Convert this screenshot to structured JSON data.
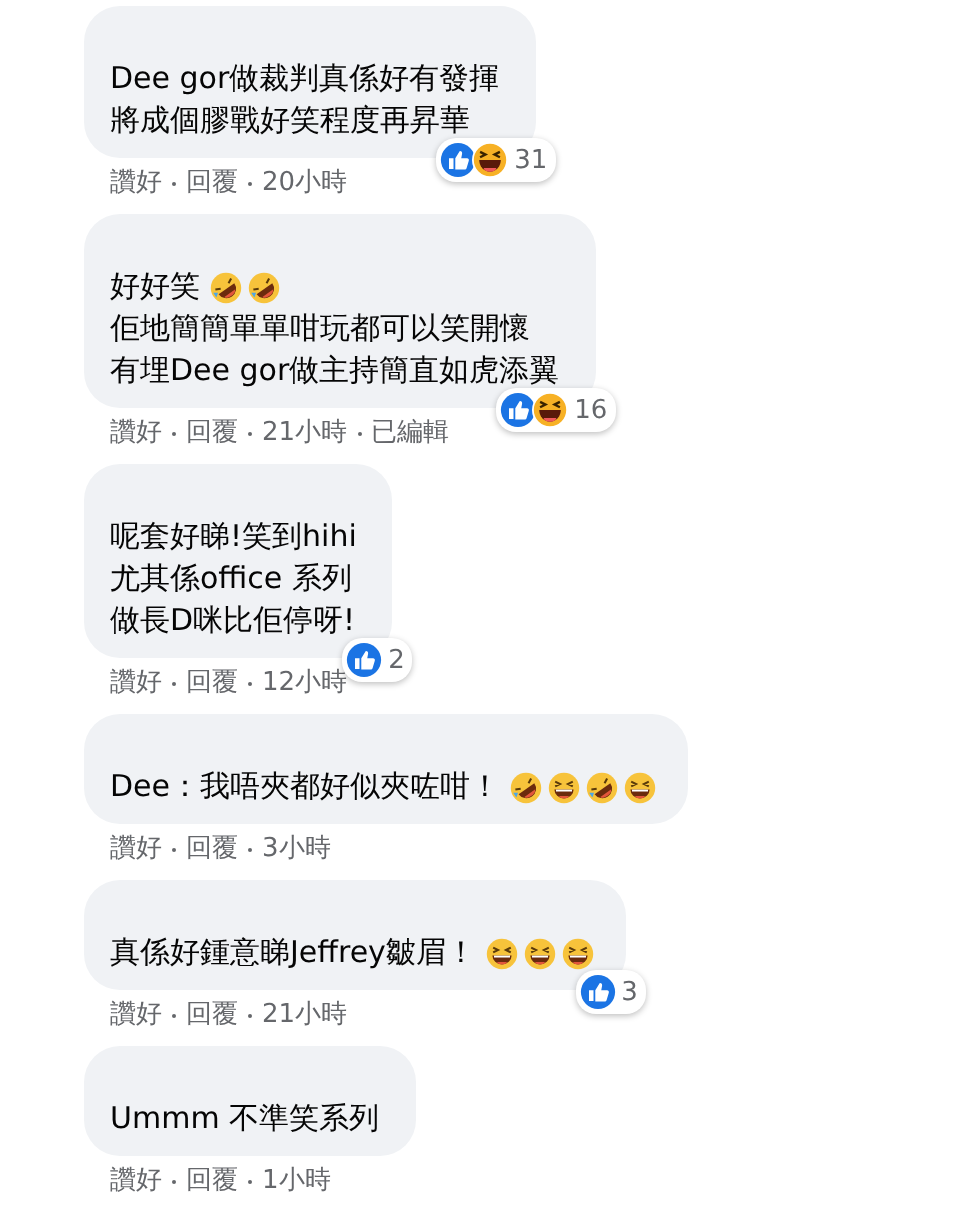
{
  "comments": [
    {
      "lines": [
        {
          "text": "Dee gor做裁判真係好有發揮"
        },
        {
          "text": "將成個膠戰好笑程度再昇華"
        }
      ],
      "reactions": {
        "icons": [
          {
            "kind": "like"
          },
          {
            "kind": "haha"
          }
        ],
        "count": "31"
      },
      "actions": [
        "讚好",
        "回覆",
        "20小時"
      ]
    },
    {
      "lines": [
        {
          "text": "好好笑",
          "emojis": [
            {
              "kind": "rofl"
            },
            {
              "kind": "rofl"
            }
          ]
        },
        {
          "text": "佢地簡簡單單咁玩都可以笑開懷"
        },
        {
          "text": "有埋Dee gor做主持簡直如虎添翼"
        }
      ],
      "reactions": {
        "icons": [
          {
            "kind": "like"
          },
          {
            "kind": "haha"
          }
        ],
        "count": "16"
      },
      "actions": [
        "讚好",
        "回覆",
        "21小時",
        "已編輯"
      ]
    },
    {
      "lines": [
        {
          "text": "呢套好睇!笑到hihi"
        },
        {
          "text": "尤其係office 系列"
        },
        {
          "text": "做長D咪比佢停呀!"
        }
      ],
      "reactions": {
        "icons": [
          {
            "kind": "like"
          }
        ],
        "count": "2"
      },
      "actions": [
        "讚好",
        "回覆",
        "12小時"
      ]
    },
    {
      "lines": [
        {
          "text": "Dee：我唔夾都好似夾咗咁！",
          "emojis": [
            {
              "kind": "rofl"
            },
            {
              "kind": "grin"
            },
            {
              "kind": "rofl"
            },
            {
              "kind": "grin"
            }
          ]
        }
      ],
      "actions": [
        "讚好",
        "回覆",
        "3小時"
      ]
    },
    {
      "lines": [
        {
          "text": "真係好鍾意睇Jeffrey皺眉！",
          "emojis": [
            {
              "kind": "grin"
            },
            {
              "kind": "grin"
            },
            {
              "kind": "grin"
            }
          ]
        }
      ],
      "reactions": {
        "icons": [
          {
            "kind": "like"
          }
        ],
        "count": "3"
      },
      "actions": [
        "讚好",
        "回覆",
        "21小時"
      ]
    },
    {
      "lines": [
        {
          "text": "Ummm 不準笑系列"
        }
      ],
      "actions": [
        "讚好",
        "回覆",
        "1小時"
      ]
    }
  ]
}
